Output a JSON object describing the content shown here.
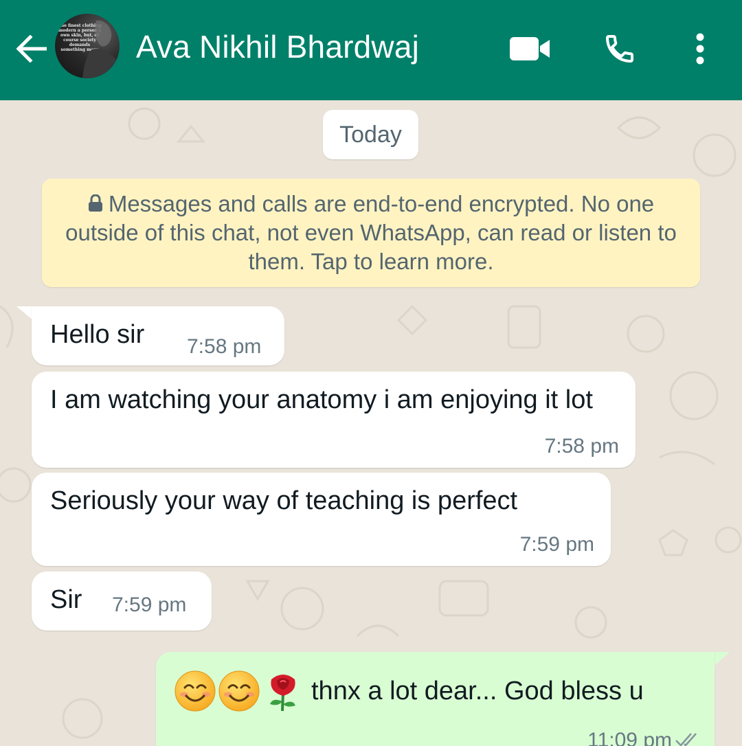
{
  "header": {
    "contact_name": "Ava Nikhil Bhardwaj",
    "background_color": "#008069",
    "icons": [
      "back-arrow-icon",
      "video-call-icon",
      "voice-call-icon",
      "more-options-icon"
    ],
    "avatar_text": "The finest clothing modern a person's own skin, but, of course society demands something more"
  },
  "chat": {
    "date_label": "Today",
    "encryption_notice": "Messages and calls are end-to-end encrypted. No one outside of this chat, not even WhatsApp, can read or listen to them. Tap to learn more.",
    "messages": [
      {
        "direction": "in",
        "text": "Hello sir",
        "time": "7:58 pm"
      },
      {
        "direction": "in",
        "text": "I am watching your anatomy i am enjoying it lot",
        "time": "7:58 pm"
      },
      {
        "direction": "in",
        "text": "Seriously your way of teaching is perfect",
        "time": "7:59 pm"
      },
      {
        "direction": "in",
        "text": "Sir",
        "time": "7:59 pm"
      },
      {
        "direction": "out",
        "emojis": [
          "smiling-face-icon",
          "smiling-face-icon",
          "rose-icon"
        ],
        "text": "thnx a lot dear... God bless u",
        "time": "11:09 pm",
        "status": "read"
      }
    ],
    "colors": {
      "incoming_bubble": "#FFFFFF",
      "outgoing_bubble": "#D9FDD3",
      "notice_bubble": "#FFF3C2",
      "read_ticks": "#8696A0"
    }
  }
}
